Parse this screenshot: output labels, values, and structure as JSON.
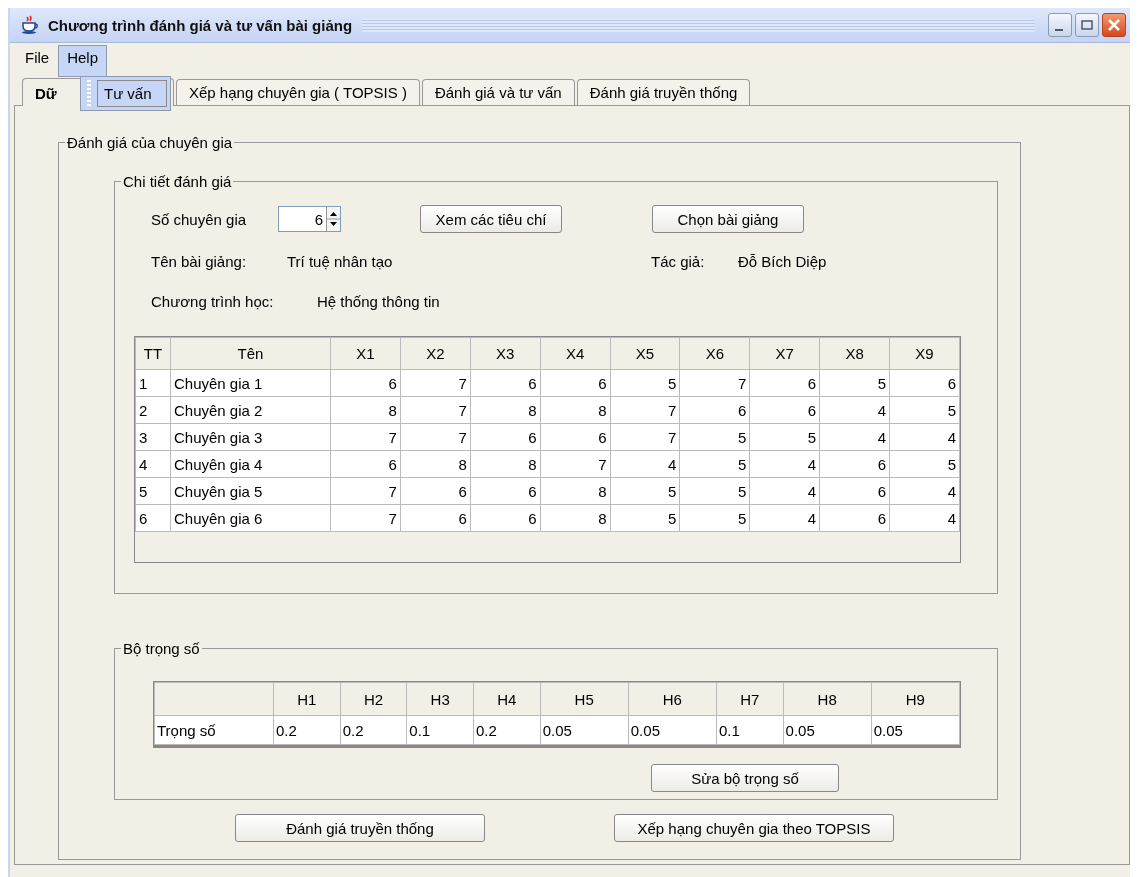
{
  "window": {
    "title": "Chương trình đánh giá và tư vấn bài giảng"
  },
  "menu": [
    {
      "label": "File",
      "selected": false
    },
    {
      "label": "Help",
      "selected": true
    }
  ],
  "open_menu": {
    "items": [
      "Tư vấn"
    ]
  },
  "tabs": [
    {
      "label": "Dữ",
      "selected": true
    },
    {
      "label": "Xếp hạng chuyên gia ( TOPSIS )",
      "selected": false
    },
    {
      "label": "Đánh giá và tư vấn",
      "selected": false
    },
    {
      "label": "Đánh giá truyền thống",
      "selected": false
    }
  ],
  "expert_panel": {
    "title": "Đánh giá của chuyên gia",
    "details": {
      "title": "Chi tiết đánh giá",
      "expert_count_label": "Số chuyên gia",
      "expert_count": "6",
      "view_criteria_button": "Xem các tiêu chí",
      "choose_lecture_button": "Chọn bài giảng",
      "lecture_name_label": "Tên bài giảng:",
      "lecture_name": "Trí tuệ nhân tạo",
      "author_label": "Tác giả:",
      "author": "Đỗ Bích Diệp",
      "program_label": "Chương trình học:",
      "program": "Hệ thống thông tin",
      "table": {
        "columns": [
          "TT",
          "Tên",
          "X1",
          "X2",
          "X3",
          "X4",
          "X5",
          "X6",
          "X7",
          "X8",
          "X9"
        ],
        "rows": [
          [
            "1",
            "Chuyên gia 1",
            "6",
            "7",
            "6",
            "6",
            "5",
            "7",
            "6",
            "5",
            "6"
          ],
          [
            "2",
            "Chuyên gia 2",
            "8",
            "7",
            "8",
            "8",
            "7",
            "6",
            "6",
            "4",
            "5"
          ],
          [
            "3",
            "Chuyên gia 3",
            "7",
            "7",
            "6",
            "6",
            "7",
            "5",
            "5",
            "4",
            "4"
          ],
          [
            "4",
            "Chuyên gia 4",
            "6",
            "8",
            "8",
            "7",
            "4",
            "5",
            "4",
            "6",
            "5"
          ],
          [
            "5",
            "Chuyên gia 5",
            "7",
            "6",
            "6",
            "8",
            "5",
            "5",
            "4",
            "6",
            "4"
          ],
          [
            "6",
            "Chuyên gia 6",
            "7",
            "6",
            "6",
            "8",
            "5",
            "5",
            "4",
            "6",
            "4"
          ]
        ]
      }
    },
    "weights": {
      "title": "Bộ trọng số",
      "columns": [
        "H1",
        "H2",
        "H3",
        "H4",
        "H5",
        "H6",
        "H7",
        "H8",
        "H9"
      ],
      "row_label": "Trọng số",
      "values": [
        "0.2",
        "0.2",
        "0.1",
        "0.2",
        "0.05",
        "0.05",
        "0.1",
        "0.05",
        "0.05"
      ],
      "edit_button": "Sửa bộ trọng số"
    },
    "buttons": [
      "Đánh giá truyền thống",
      "Xếp hạng chuyên gia theo TOPSIS"
    ]
  }
}
